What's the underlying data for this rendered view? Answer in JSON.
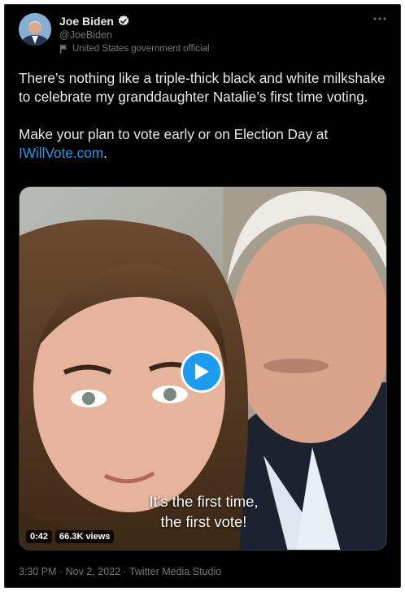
{
  "author": {
    "name": "Joe Biden",
    "handle": "@JoeBiden",
    "label": "United States government official",
    "avatar_icon": "avatar-photo",
    "verified_icon": "verified-badge-icon",
    "label_icon": "flag-icon"
  },
  "tweet": {
    "paragraph1": "There’s nothing like a triple-thick black and white milkshake to celebrate my granddaughter Natalie’s first time voting.",
    "paragraph2_prefix": "Make your plan to vote early or on Election Day at ",
    "link_text": "IWillVote.com",
    "paragraph2_suffix": "."
  },
  "media": {
    "caption_line1": "It's the first time,",
    "caption_line2": "the first vote!",
    "duration": "0:42",
    "views": "66.3K views",
    "play_icon": "play-icon"
  },
  "footer": {
    "meta": "3:30 PM · Nov 2, 2022 · Twitter Media Studio"
  },
  "colors": {
    "background": "#000000",
    "text": "#e7e9ea",
    "secondary": "#71767b",
    "accent": "#1d9bf0"
  }
}
